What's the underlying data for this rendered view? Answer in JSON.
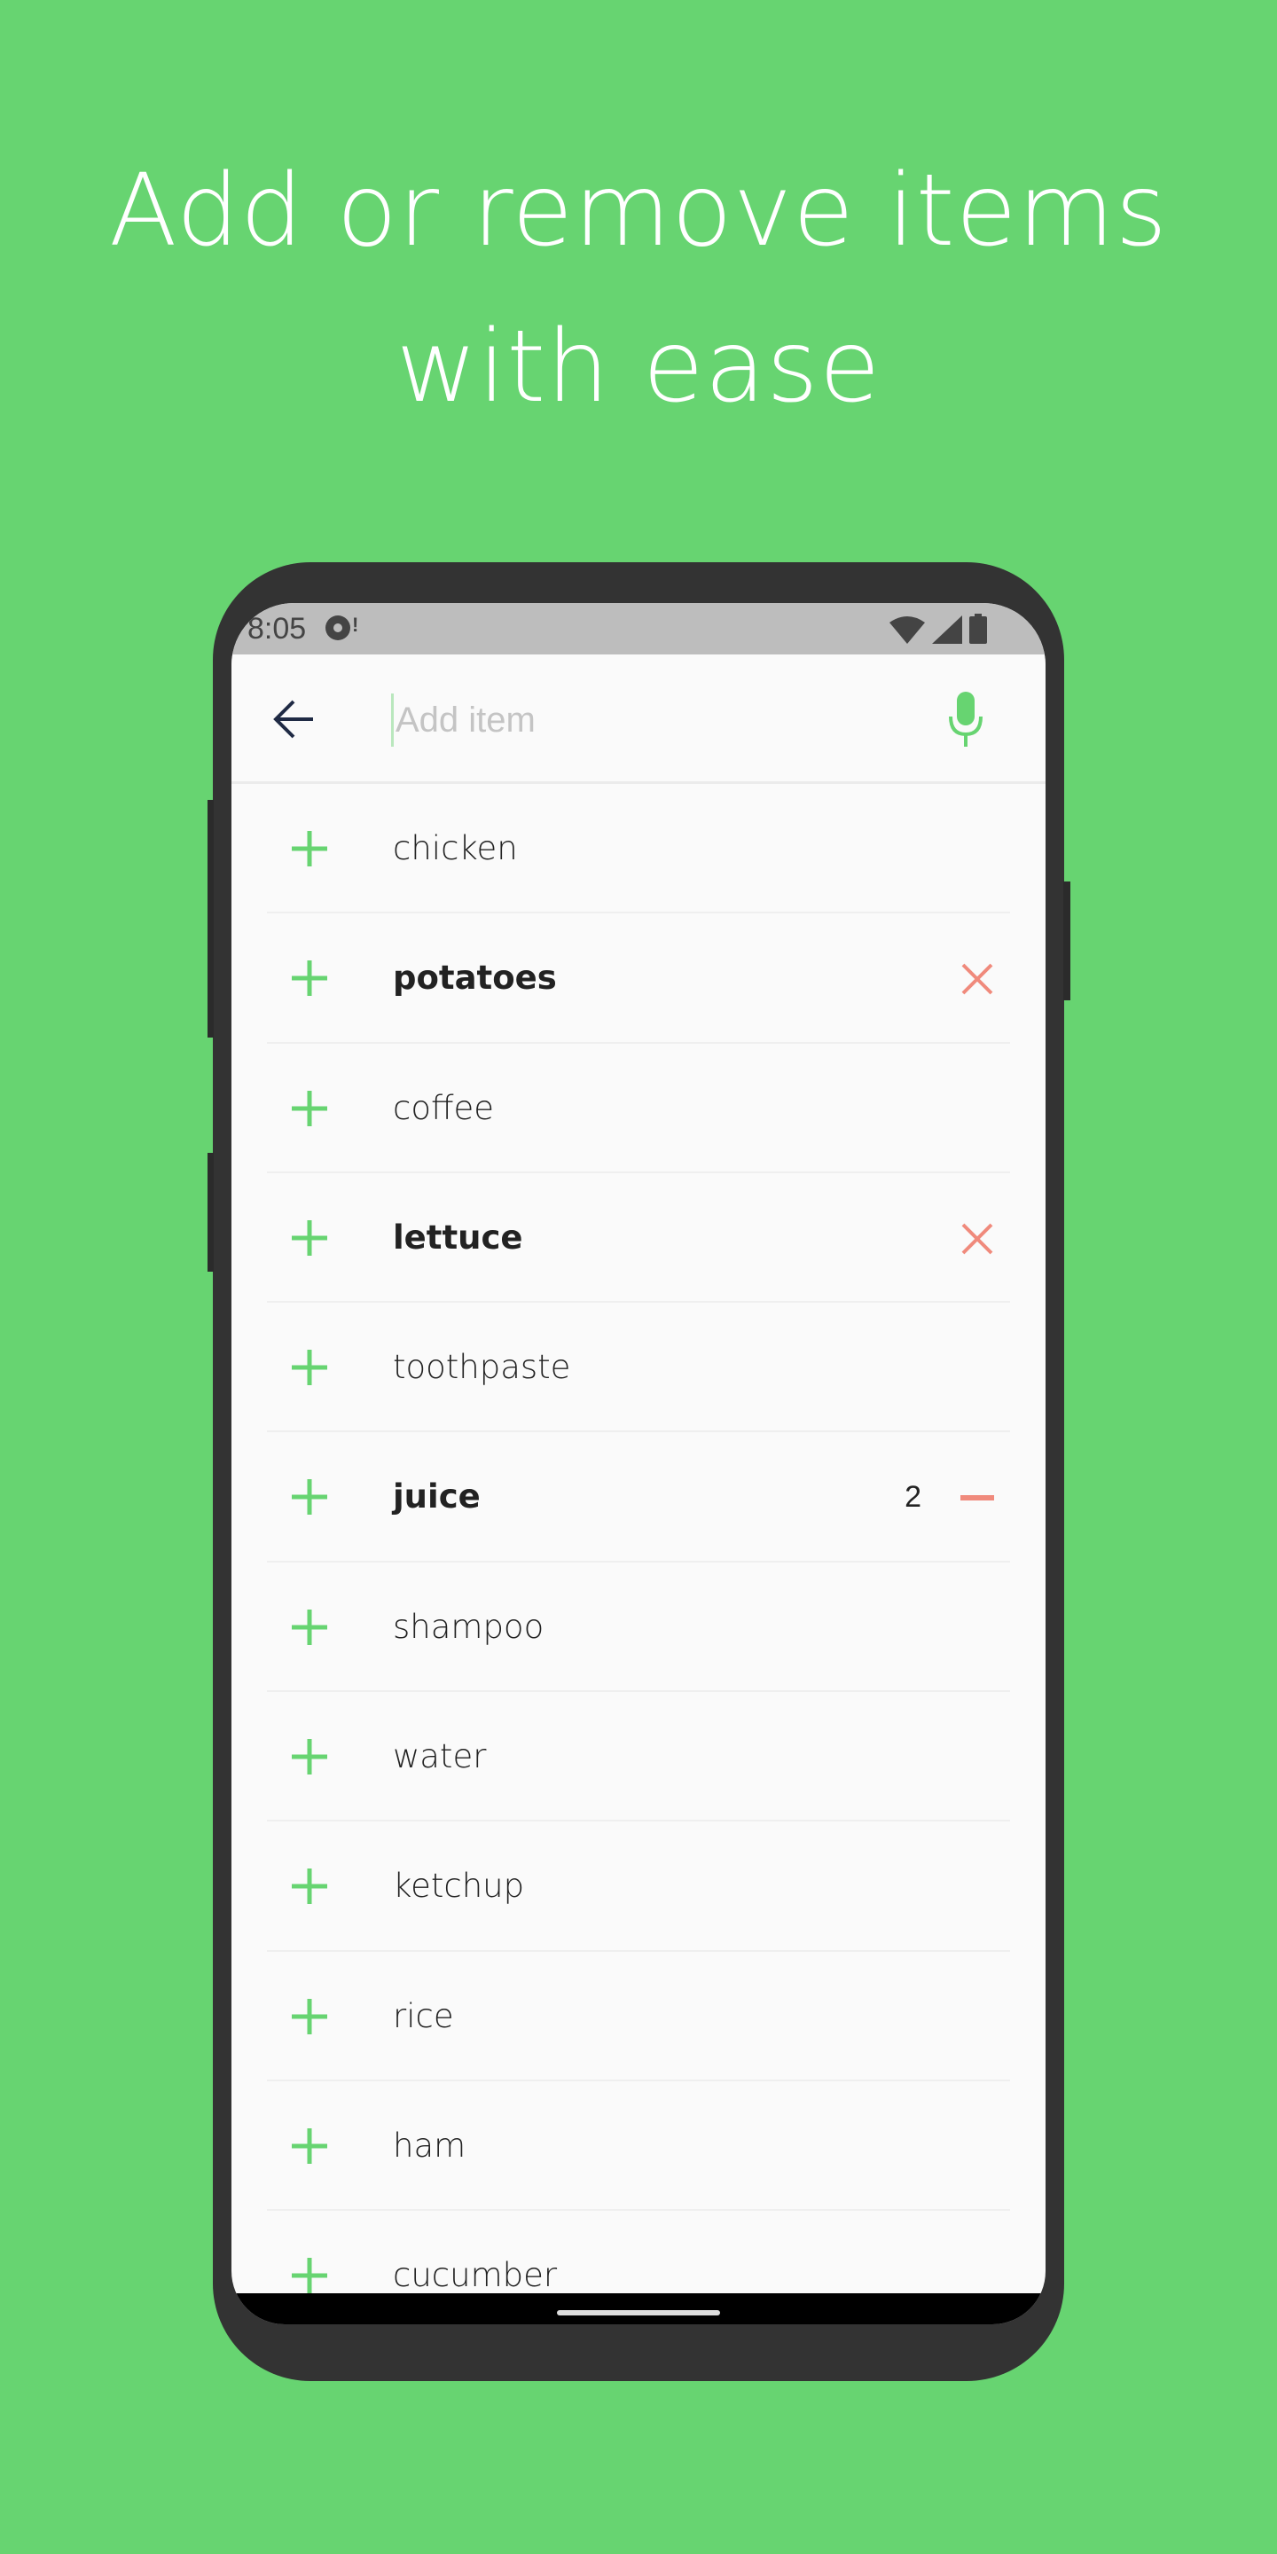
{
  "headline": {
    "line1": "Add or remove items",
    "line2": "with ease"
  },
  "status_bar": {
    "time": "8:05",
    "notification_icon": "vinyl-record-icon",
    "icons": [
      "wifi-icon",
      "signal-icon",
      "battery-icon"
    ]
  },
  "app_bar": {
    "back_icon": "arrow-left-icon",
    "input_value": "",
    "input_placeholder": "Add item",
    "mic_icon": "microphone-icon"
  },
  "colors": {
    "background": "#67d471",
    "accent": "#67d471",
    "remove": "#f08a7c",
    "device": "#333333"
  },
  "items": [
    {
      "name": "chicken",
      "selected": false
    },
    {
      "name": "potatoes",
      "selected": true,
      "action": "remove"
    },
    {
      "name": "coffee",
      "selected": false
    },
    {
      "name": "lettuce",
      "selected": true,
      "action": "remove"
    },
    {
      "name": "toothpaste",
      "selected": false
    },
    {
      "name": "juice",
      "selected": true,
      "count": "2",
      "action": "decrement"
    },
    {
      "name": "shampoo",
      "selected": false
    },
    {
      "name": "water",
      "selected": false
    },
    {
      "name": "ketchup",
      "selected": false
    },
    {
      "name": "rice",
      "selected": false
    },
    {
      "name": "ham",
      "selected": false
    },
    {
      "name": "cucumber",
      "selected": false
    }
  ]
}
